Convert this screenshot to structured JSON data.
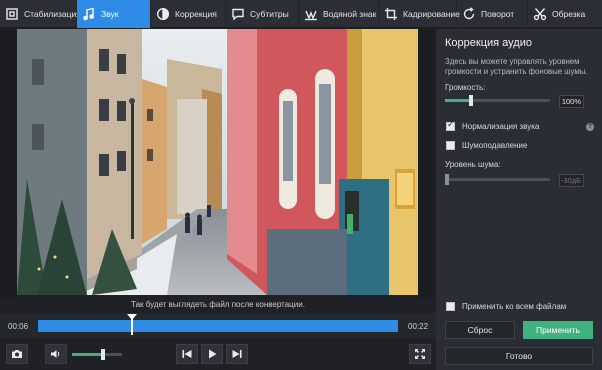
{
  "tabs": [
    {
      "label": "Стабилизация",
      "icon": "stabilization-icon",
      "active": false
    },
    {
      "label": "Звук",
      "icon": "music-note-icon",
      "active": true
    },
    {
      "label": "Коррекция",
      "icon": "contrast-icon",
      "active": false
    },
    {
      "label": "Субтитры",
      "icon": "subtitles-icon",
      "active": false
    },
    {
      "label": "Водяной знак",
      "icon": "watermark-icon",
      "active": false
    },
    {
      "label": "Кадрирование",
      "icon": "crop-icon",
      "active": false
    },
    {
      "label": "Поворот",
      "icon": "rotate-icon",
      "active": false
    },
    {
      "label": "Обрезка",
      "icon": "scissors-icon",
      "active": false
    }
  ],
  "preview": {
    "hint": "Так будет выглядеть файл после конвертации."
  },
  "timeline": {
    "start_time": "00:06",
    "end_time": "00:22",
    "position": 0.26
  },
  "controls": {
    "volume_level": 0.62
  },
  "panel": {
    "title": "Коррекция аудио",
    "description": "Здесь вы можете управлять уровнем громкости и устранить фоновые шумы.",
    "volume_label": "Громкость:",
    "volume_value": "100%",
    "volume_level": 0.25,
    "normalize_label": "Нормализация звука",
    "normalize_checked": true,
    "help_glyph": "?",
    "denoise_label": "Шумоподавление",
    "denoise_checked": false,
    "noise_label": "Уровень шума:",
    "noise_value": "-30дБ",
    "noise_level": 0.0,
    "apply_all_label": "Применить ко всем файлам",
    "apply_all_checked": false,
    "reset_label": "Сброс",
    "apply_label": "Применить",
    "done_label": "Готово"
  },
  "colors": {
    "accent_blue": "#2f8ce6",
    "accent_green": "#3fb27f",
    "panel_bg": "#2a2d33",
    "app_bg": "#1f2126"
  }
}
